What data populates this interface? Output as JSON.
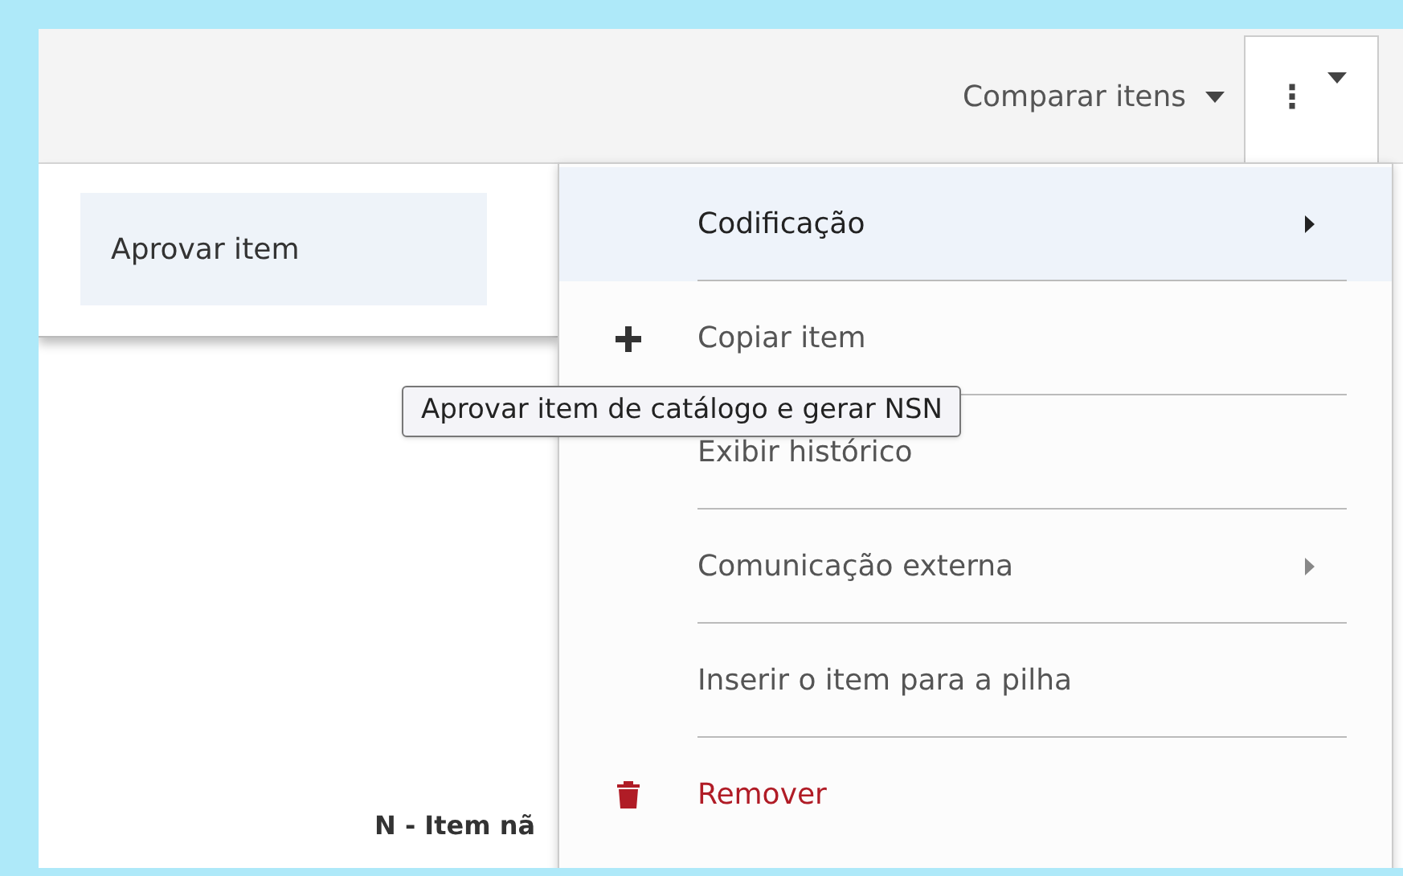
{
  "toolbar": {
    "compare_button": {
      "label": "Comparar itens"
    },
    "more_button": {
      "label": "⋮"
    }
  },
  "background_text": "N - Item nã",
  "submenu": {
    "items": [
      {
        "label": "Aprovar item",
        "selected": true
      }
    ]
  },
  "menu": {
    "items": [
      {
        "label": "Codificação",
        "kind": "submenu",
        "selected": true
      },
      {
        "label": "Copiar item",
        "kind": "add",
        "selected": false
      },
      {
        "label": "Exibir histórico",
        "kind": "plain",
        "selected": false
      },
      {
        "label": "Comunicação externa",
        "kind": "submenu",
        "selected": false
      },
      {
        "label": "Inserir o item para a pilha",
        "kind": "plain",
        "selected": false
      },
      {
        "label": "Remover",
        "kind": "danger",
        "selected": false
      }
    ]
  },
  "tooltip": "Aprovar item de catálogo e gerar NSN"
}
